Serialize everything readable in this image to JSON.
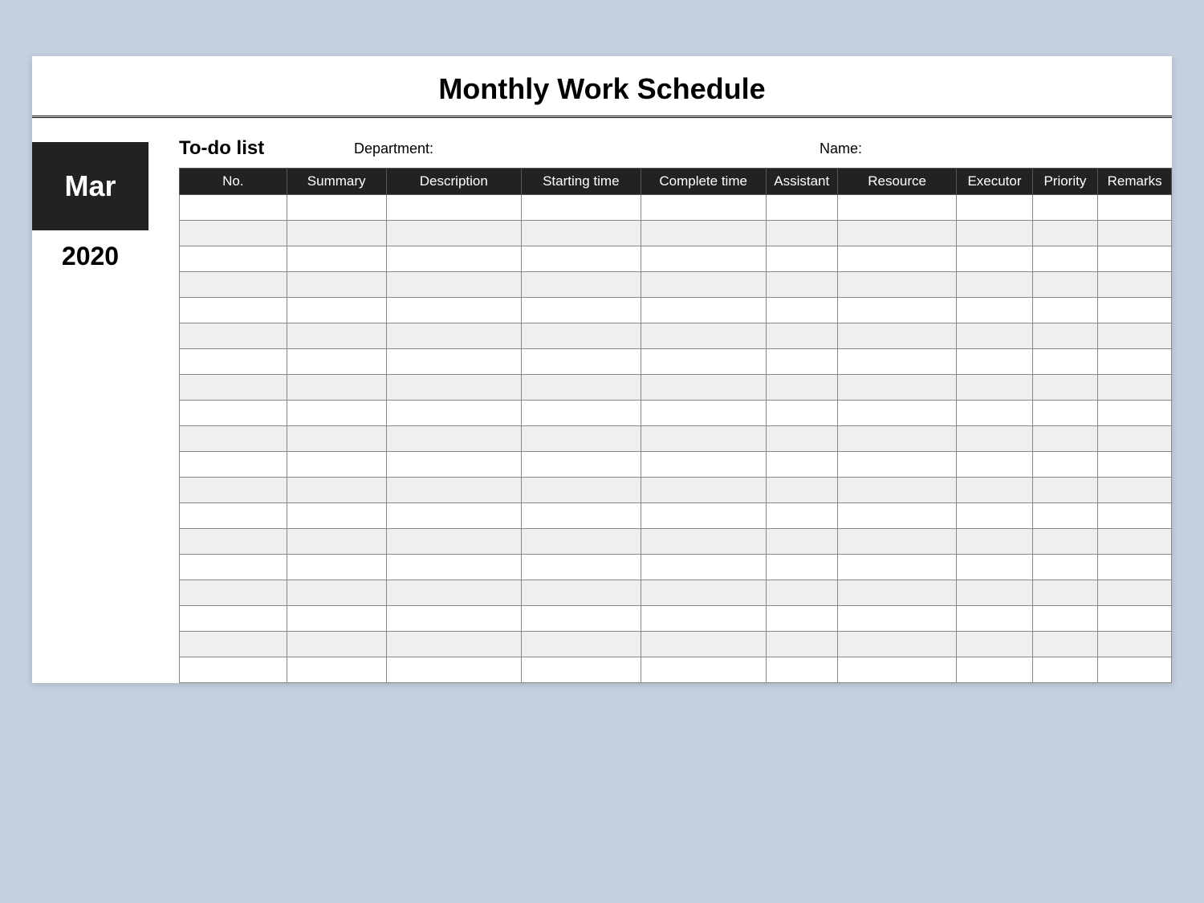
{
  "title": "Monthly Work Schedule",
  "sidebar": {
    "month": "Mar",
    "year": "2020"
  },
  "meta": {
    "todo_label": "To-do list",
    "department_label": "Department:",
    "name_label": "Name:"
  },
  "table": {
    "headers": {
      "no": "No.",
      "summary": "Summary",
      "description": "Description",
      "starting_time": "Starting time",
      "complete_time": "Complete time",
      "assistant": "Assistant",
      "resource": "Resource",
      "executor": "Executor",
      "priority": "Priority",
      "remarks": "Remarks"
    },
    "row_count": 19
  }
}
